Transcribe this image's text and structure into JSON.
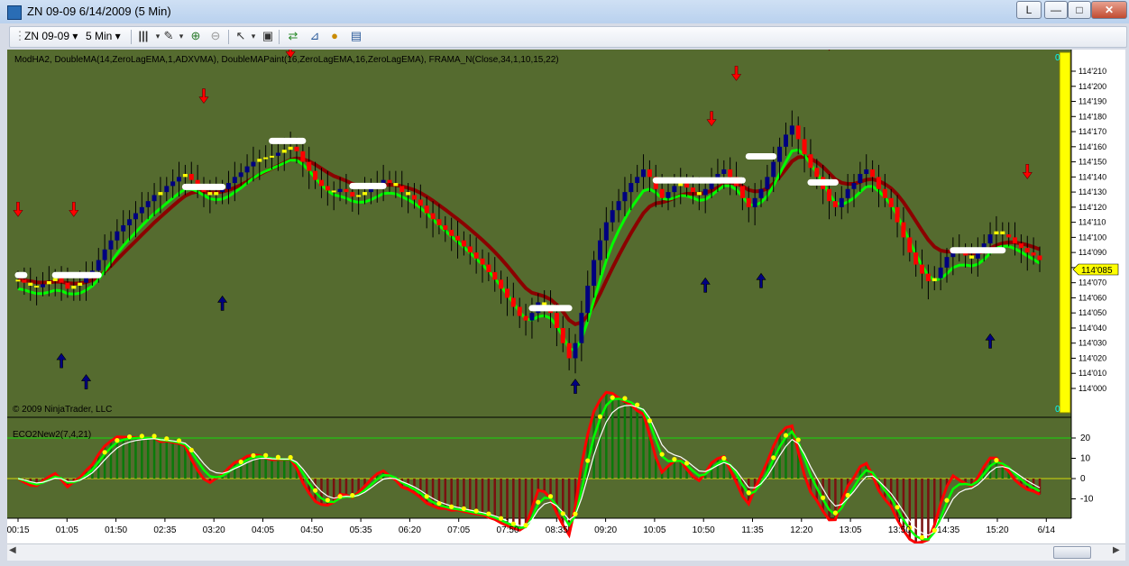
{
  "window": {
    "title": "ZN 09-09  6/14/2009 (5 Min)",
    "legend_button": "L",
    "minimize": "—",
    "maximize": "□",
    "close": "✕"
  },
  "toolbar": {
    "instrument": "ZN 09-09",
    "interval": "5 Min"
  },
  "price_panel": {
    "indicator_label": "ModHA2, DoubleMA(14,ZeroLagEMA,1,ADXVMA), DoubleMAPaint(16,ZeroLagEMA,16,ZeroLagEMA), FRAMA_N(Close,34,1,10,15,22)",
    "copyright": "© 2009 NinjaTrader, LLC",
    "current_price": "114'085",
    "scale_top_label": "0",
    "scale_bottom_label": "0",
    "y_tick_labels": [
      "114'210",
      "114'200",
      "114'190",
      "114'180",
      "114'170",
      "114'160",
      "114'150",
      "114'140",
      "114'130",
      "114'120",
      "114'110",
      "114'100",
      "114'090",
      "114'080",
      "114'070",
      "114'060",
      "114'050",
      "114'040",
      "114'030",
      "114'020",
      "114'010",
      "114'000"
    ]
  },
  "osc_panel": {
    "label": "ECO2New2(7,4,21)",
    "y_tick_labels": [
      "20",
      "10",
      "0",
      "-10"
    ]
  },
  "x_tick_labels": [
    "00:15",
    "01:05",
    "01:50",
    "02:35",
    "03:20",
    "04:05",
    "04:50",
    "05:35",
    "06:20",
    "07:05",
    "07:50",
    "08:35",
    "09:20",
    "10:05",
    "10:50",
    "11:35",
    "12:20",
    "13:05",
    "13:50",
    "14:35",
    "15:20",
    "6/14"
  ],
  "colors": {
    "background": "#556b2f",
    "up": "#000080",
    "down": "#ff0000",
    "doji": "#ffff00",
    "fast_ma": "#00ff00",
    "slow_ma": "#8b0000",
    "frama": "#ffffff",
    "scale_bar": "#ffff00"
  },
  "chart_data": {
    "type": "candlestick",
    "price_axis": {
      "ylim": [
        "114'000",
        "114'220"
      ],
      "unit": "32nds"
    },
    "closes": [
      114.072,
      114.07,
      114.068,
      114.067,
      114.069,
      114.071,
      114.073,
      114.07,
      114.066,
      114.068,
      114.07,
      114.074,
      114.078,
      114.085,
      114.092,
      114.098,
      114.104,
      114.108,
      114.112,
      114.116,
      114.12,
      114.124,
      114.128,
      114.13,
      114.134,
      114.137,
      114.14,
      114.142,
      114.138,
      114.134,
      114.13,
      114.128,
      114.13,
      114.132,
      114.136,
      114.14,
      114.143,
      114.147,
      114.15,
      114.152,
      114.153,
      114.154,
      114.156,
      114.158,
      114.16,
      114.157,
      114.15,
      114.144,
      114.138,
      114.134,
      114.131,
      114.13,
      114.132,
      114.13,
      114.127,
      114.128,
      114.13,
      114.133,
      114.136,
      114.138,
      114.136,
      114.134,
      114.13,
      114.128,
      114.125,
      114.121,
      114.116,
      114.112,
      114.108,
      114.105,
      114.101,
      114.098,
      114.094,
      114.09,
      114.086,
      114.082,
      114.077,
      114.072,
      114.066,
      114.06,
      114.054,
      114.048,
      114.045,
      114.05,
      114.057,
      114.055,
      114.05,
      114.04,
      114.03,
      114.02,
      114.03,
      114.05,
      114.068,
      114.085,
      114.098,
      114.11,
      114.118,
      114.124,
      114.13,
      114.136,
      114.14,
      114.145,
      114.14,
      114.132,
      114.126,
      114.13,
      114.134,
      114.136,
      114.133,
      114.13,
      114.128,
      114.132,
      114.138,
      114.142,
      114.145,
      114.14,
      114.134,
      114.126,
      114.12,
      114.126,
      114.132,
      114.14,
      114.15,
      114.16,
      114.168,
      114.174,
      114.165,
      114.155,
      114.146,
      114.14,
      114.132,
      114.124,
      114.12,
      114.126,
      114.132,
      114.136,
      114.142,
      114.145,
      114.14,
      114.132,
      114.126,
      114.12,
      114.11,
      114.1,
      114.09,
      114.082,
      114.076,
      114.071,
      114.073,
      114.08,
      114.087,
      114.092,
      114.09,
      114.088,
      114.086,
      114.09,
      114.096,
      114.102,
      114.104,
      114.102,
      114.1,
      114.096,
      114.093,
      114.09,
      114.088,
      114.085
    ]
  }
}
